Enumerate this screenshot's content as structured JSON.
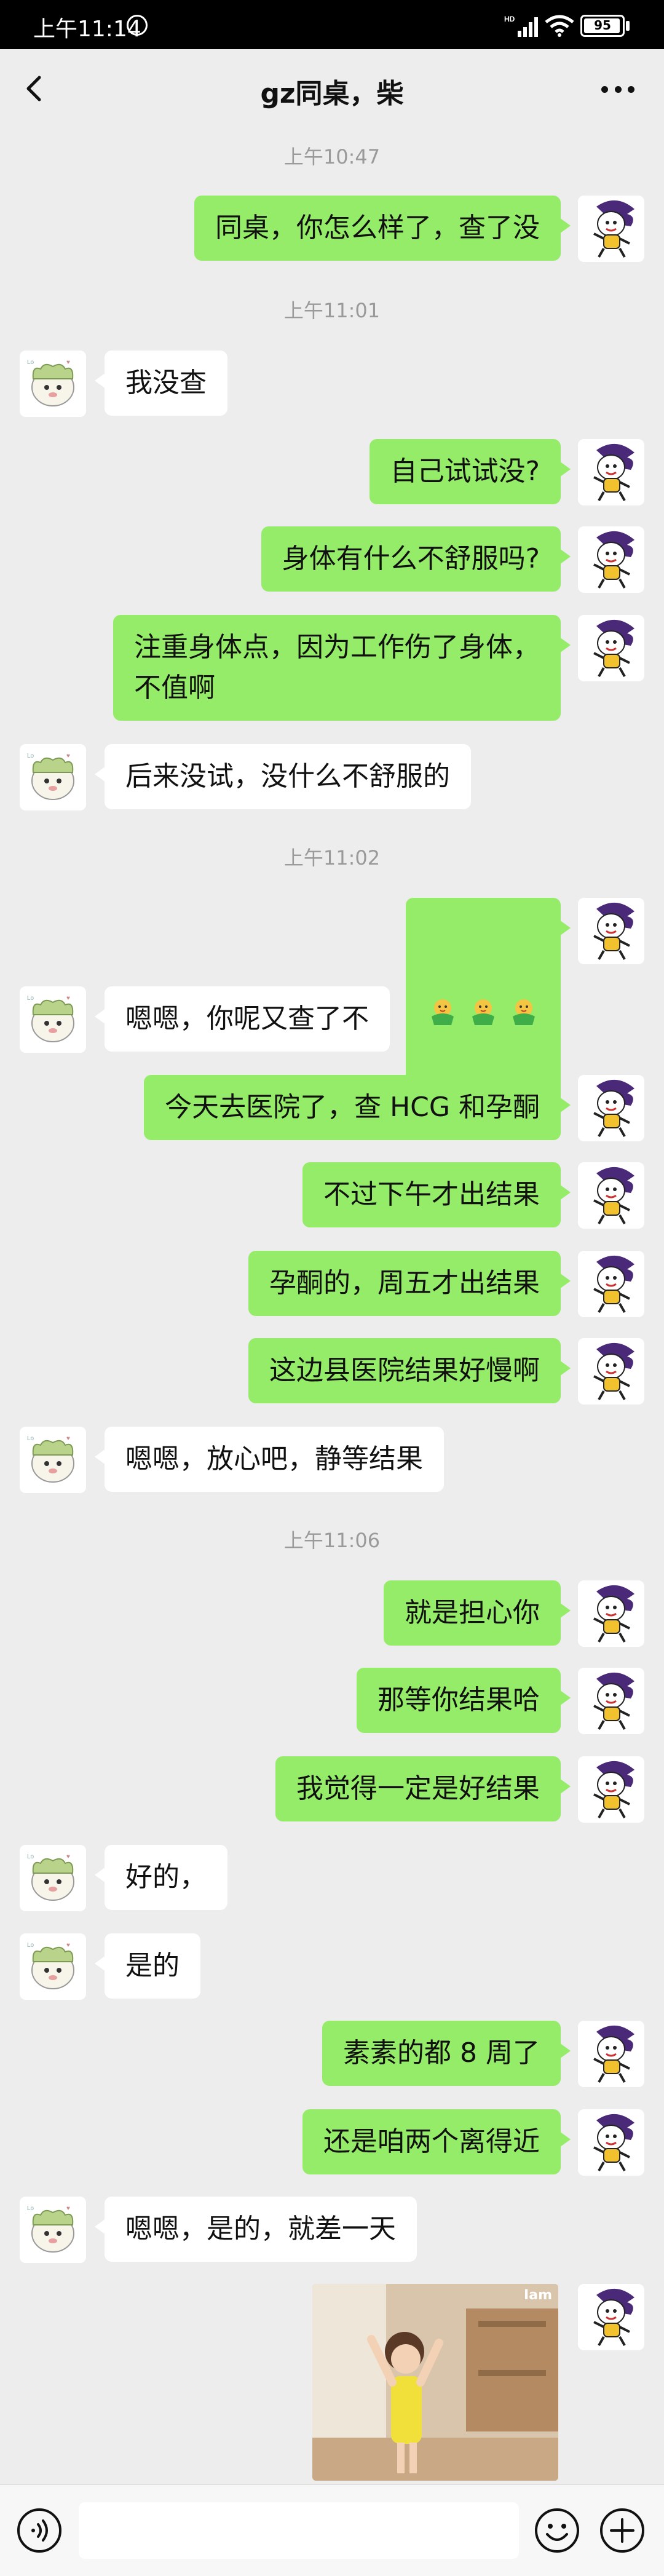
{
  "status_bar": {
    "time": "上午11:14",
    "battery": "95"
  },
  "header": {
    "title": "gz同桌，柴"
  },
  "messages": [
    {
      "type": "time",
      "text": "上午10:47"
    },
    {
      "type": "sent",
      "text": "同桌，你怎么样了，查了没"
    },
    {
      "type": "time",
      "text": "上午11:01"
    },
    {
      "type": "recv",
      "text": "我没查"
    },
    {
      "type": "sent",
      "text": "自己试试没?"
    },
    {
      "type": "sent",
      "text": "身体有什么不舒服吗?"
    },
    {
      "type": "sent",
      "text": "注重身体点，因为工作伤了身体，\n不值啊"
    },
    {
      "type": "recv",
      "text": "后来没试，没什么不舒服的"
    },
    {
      "type": "time",
      "text": "上午11:02"
    },
    {
      "type": "sent_emoji",
      "icon": "chick-emoji-icon",
      "count": 3
    },
    {
      "type": "recv",
      "text": "嗯嗯，你呢又查了不"
    },
    {
      "type": "sent",
      "text": "今天去医院了，查 HCG 和孕酮"
    },
    {
      "type": "sent",
      "text": "不过下午才出结果"
    },
    {
      "type": "sent",
      "text": "孕酮的，周五才出结果"
    },
    {
      "type": "sent",
      "text": "这边县医院结果好慢啊"
    },
    {
      "type": "recv",
      "text": "嗯嗯，放心吧，静等结果"
    },
    {
      "type": "time",
      "text": "上午11:06"
    },
    {
      "type": "sent",
      "text": "就是担心你"
    },
    {
      "type": "sent",
      "text": "那等你结果哈"
    },
    {
      "type": "sent",
      "text": "我觉得一定是好结果"
    },
    {
      "type": "recv",
      "text": "好的，"
    },
    {
      "type": "recv",
      "text": "是的"
    },
    {
      "type": "sent",
      "text": "素素的都 8 周了"
    },
    {
      "type": "sent",
      "text": "还是咱两个离得近"
    },
    {
      "type": "recv",
      "text": "嗯嗯，是的，就差一天"
    },
    {
      "type": "sent_image",
      "watermark": "Iam"
    }
  ],
  "colors": {
    "sent_bubble": "#95ec69",
    "recv_bubble": "#ffffff",
    "background": "#ededed"
  }
}
